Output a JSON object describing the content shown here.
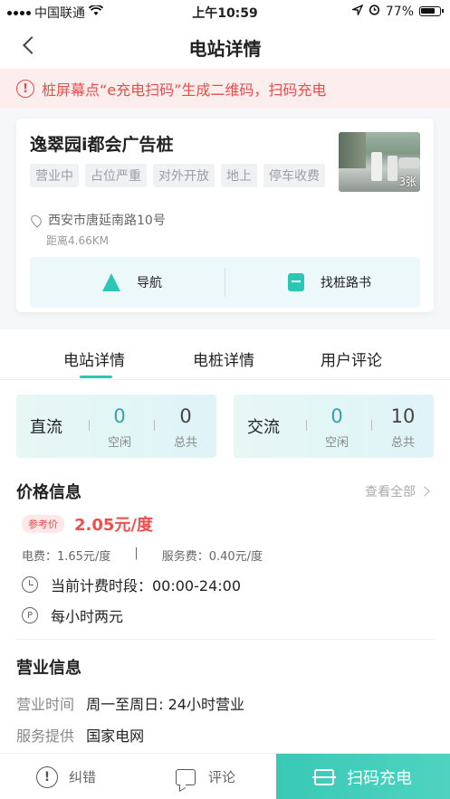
{
  "status_bar": {
    "carrier": "中国联通",
    "time": "上午10:59",
    "battery": "77%"
  },
  "nav": {
    "title": "电站详情"
  },
  "notice": {
    "text": "桩屏幕点“e充电扫码”生成二维码，扫码充电"
  },
  "station": {
    "name": "逸翠园i都会广告桩",
    "tags": [
      "营业中",
      "占位严重",
      "对外开放",
      "地上",
      "停车收费"
    ],
    "photo_count": "3张",
    "address": "西安市唐延南路10号",
    "distance": "距离4.66KM",
    "nav_label": "导航",
    "book_label": "找桩路书"
  },
  "tabs": [
    "电站详情",
    "电桩详情",
    "用户评论"
  ],
  "stats": {
    "dc": {
      "type": "直流",
      "free": "0",
      "free_label": "空闲",
      "total": "0",
      "total_label": "总共"
    },
    "ac": {
      "type": "交流",
      "free": "0",
      "free_label": "空闲",
      "total": "10",
      "total_label": "总共"
    }
  },
  "price": {
    "title": "价格信息",
    "see_all": "查看全部",
    "ref_tag": "参考价",
    "value": "2.05元/度",
    "electricity_fee": "电费：1.65元/度",
    "separator": "|",
    "service_fee": "服务费：0.40元/度",
    "period": "当前计费时段：00:00-24:00",
    "parking": "每小时两元",
    "parking_icon_text": "P"
  },
  "business": {
    "title": "营业信息",
    "hours_label": "营业时间",
    "hours_value": "周一至周日: 24小时营业",
    "provider_label": "服务提供",
    "provider_value": "国家电网"
  },
  "bottom": {
    "report_label": "纠错",
    "report_icon": "!",
    "comment_label": "评论",
    "scan_label": "扫码充电"
  },
  "colors": {
    "accent": "#2cc7b4",
    "warning": "#e84c4c",
    "price": "#f04d4d"
  }
}
